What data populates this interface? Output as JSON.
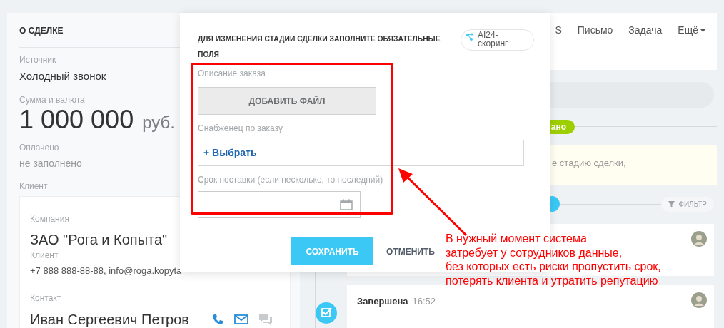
{
  "deal_panel": {
    "title": "О СДЕЛКЕ",
    "source": {
      "label": "Источник",
      "value": "Холодный звонок"
    },
    "amount": {
      "label": "Сумма и валюта",
      "value": "1 000 000",
      "currency": "руб."
    },
    "paid": {
      "label": "Оплачено",
      "value": "не заполнено"
    },
    "client": {
      "label": "Клиент",
      "company_label": "Компания",
      "company_name": "ЗАО \"Рога и Копыта\"",
      "company_role": "Клиент",
      "company_contacts": "+7 888 888-88-88, info@roga.kopyta",
      "contact_label": "Контакт",
      "contact_name": "Иван Сергеевич Петров"
    }
  },
  "timeline": {
    "tabs": [
      {
        "label": "S"
      },
      {
        "label": "Письмо"
      },
      {
        "label": "Задача"
      },
      {
        "label": "Ещё"
      }
    ],
    "stage_badge": "ано",
    "notice": "е стадию сделки,",
    "filter": "ФИЛЬТР",
    "event": {
      "status": "Завершена",
      "time": "16:52"
    }
  },
  "modal": {
    "title": "ДЛЯ ИЗМЕНЕНИЯ СТАДИИ СДЕЛКИ ЗАПОЛНИТЕ ОБЯЗАТЕЛЬНЫЕ ПОЛЯ",
    "scoring_badge": "AI24-скоринг",
    "fields": [
      {
        "kind": "file",
        "label": "Описание заказа",
        "action": "ДОБАВИТЬ ФАЙЛ"
      },
      {
        "kind": "selector",
        "label": "Снабженец по заказу",
        "action": "+ Выбрать"
      },
      {
        "kind": "date",
        "label": "Срок поставки (если несколько, то последний)"
      }
    ],
    "buttons": [
      {
        "label": "СОХРАНИТЬ",
        "primary": true
      },
      {
        "label": "ОТМЕНИТЬ",
        "primary": false
      }
    ]
  },
  "annotation": {
    "lines": [
      "В нужный момент система",
      "затребует у сотрудников данные,",
      "без которых есть риски пропустить срок,",
      "потерять клиента и утратить репутацию"
    ]
  }
}
